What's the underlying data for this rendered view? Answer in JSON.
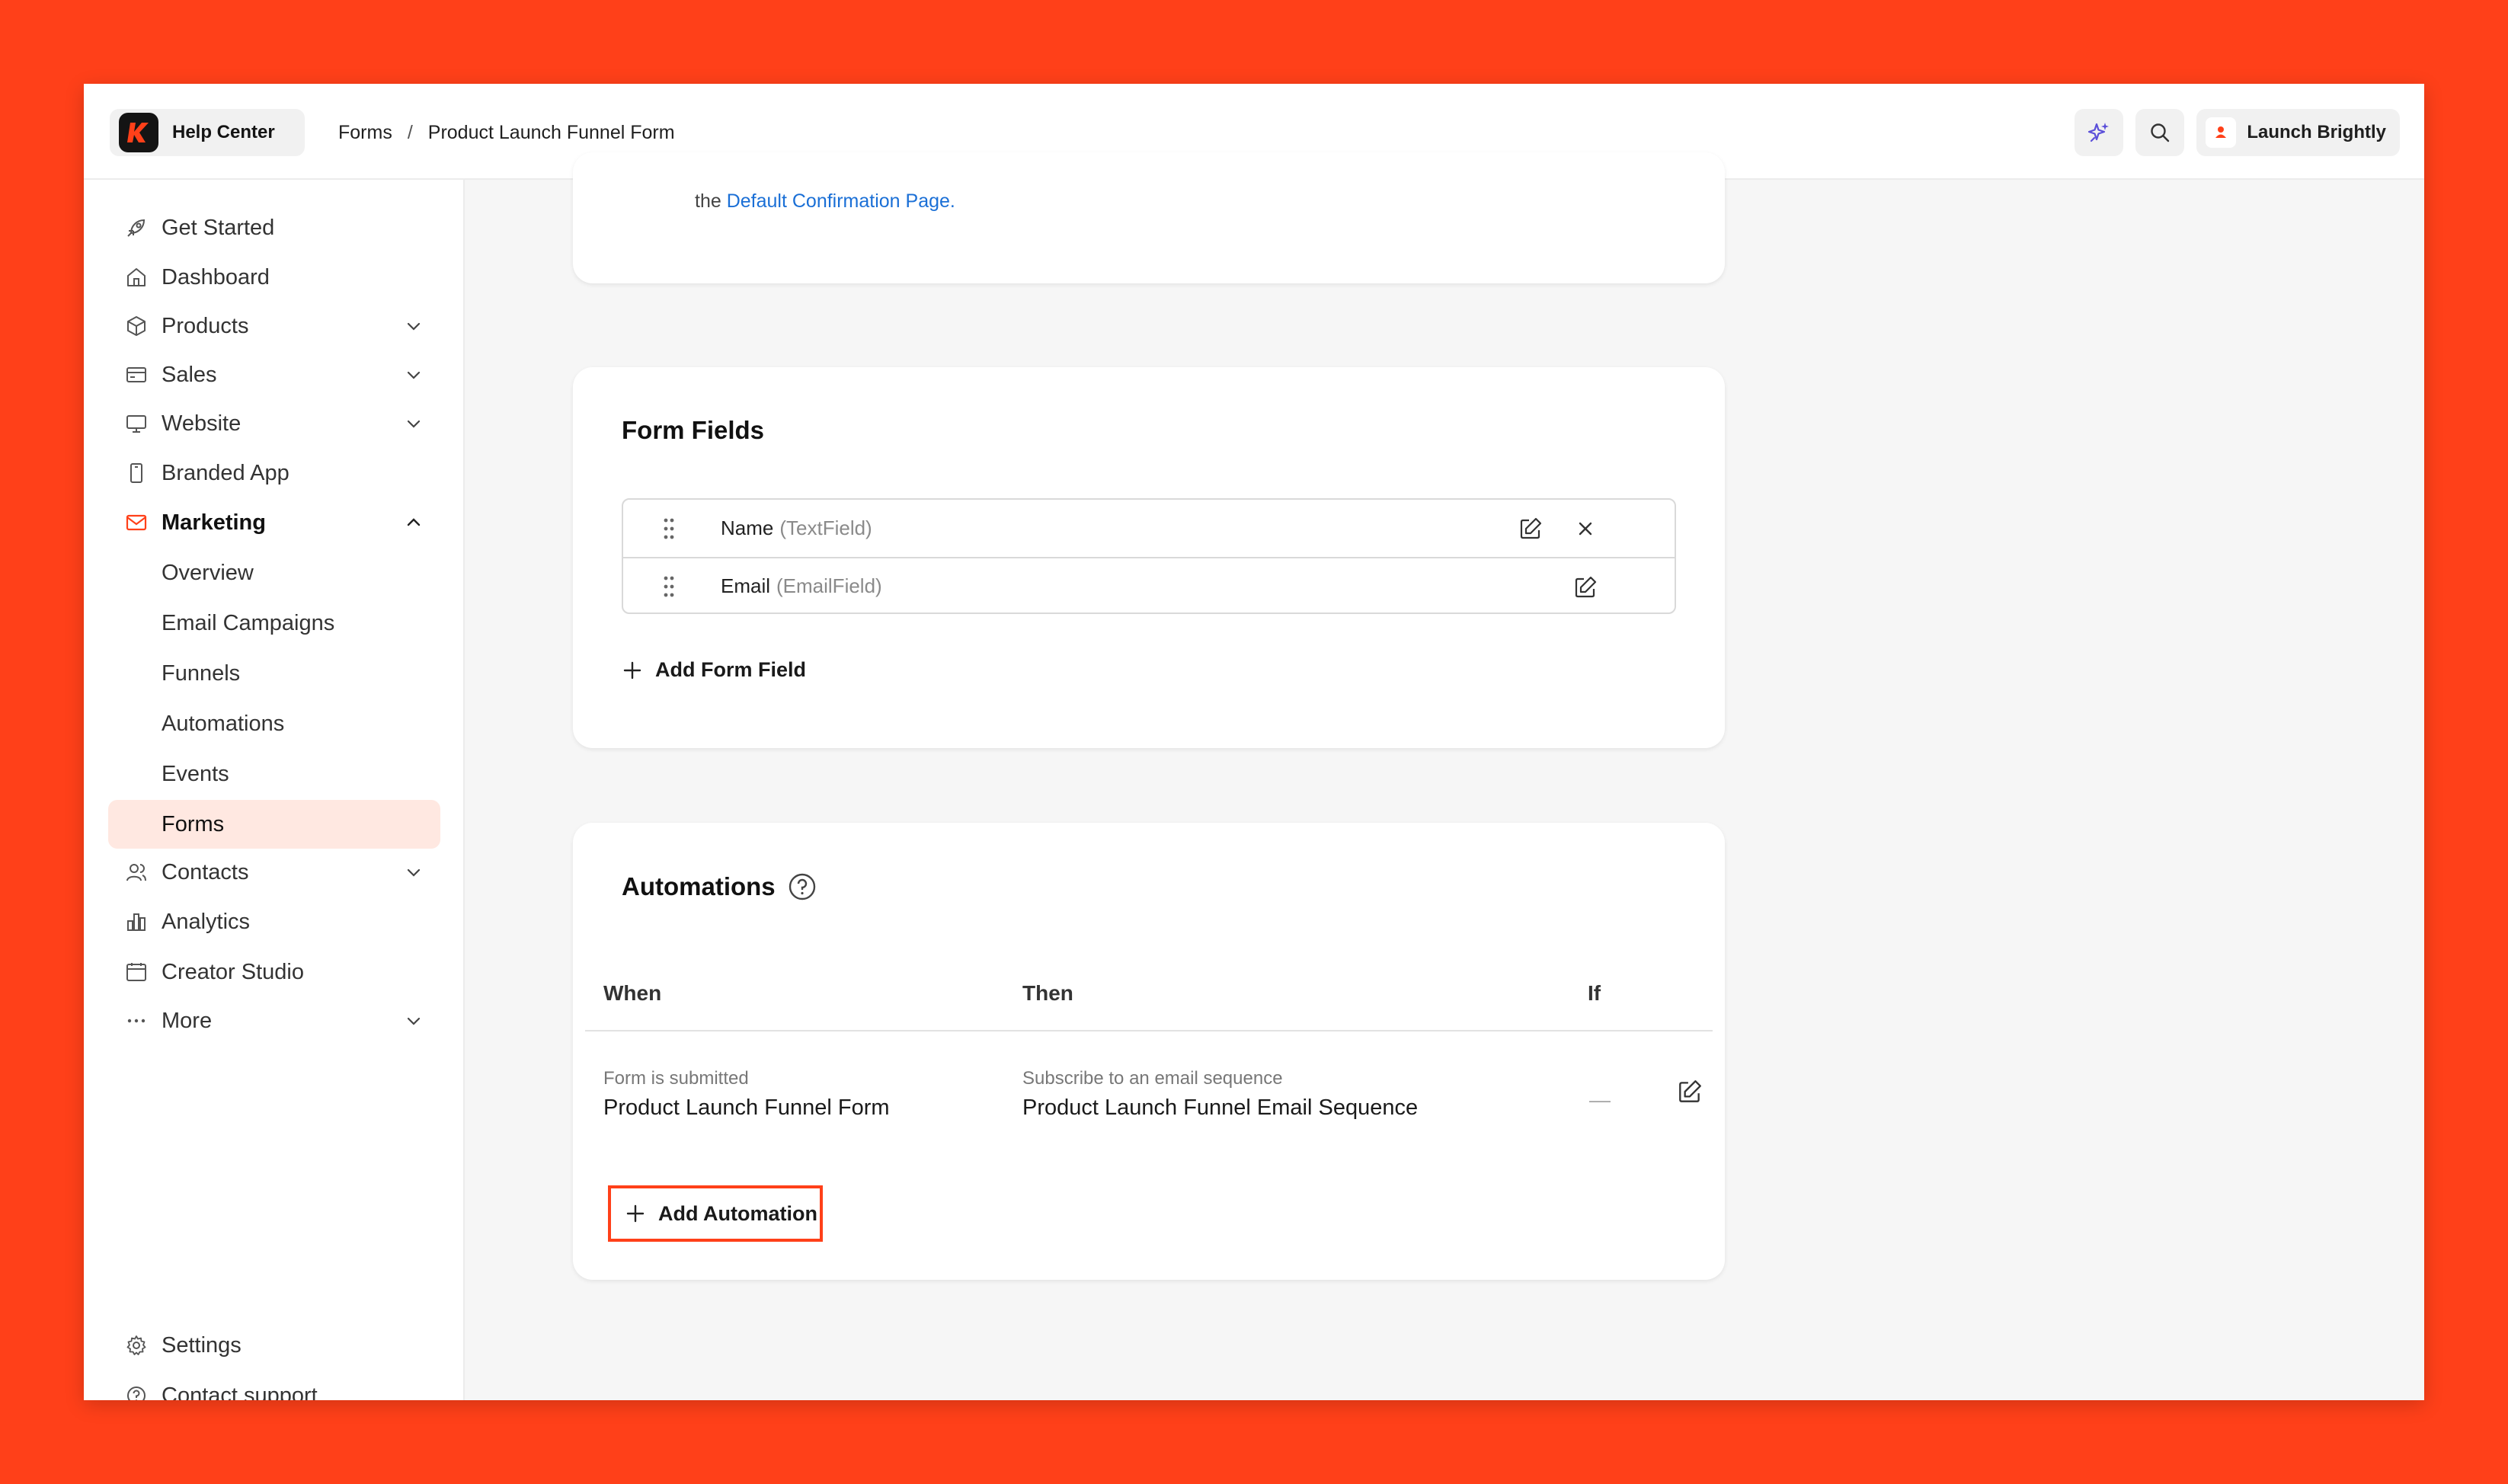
{
  "header": {
    "logo_text": "Help Center",
    "breadcrumb": [
      "Forms",
      "Product Launch Funnel Form"
    ],
    "breadcrumb_separator": "/",
    "account_name": "Launch Brightly"
  },
  "sidebar": {
    "items": [
      {
        "label": "Get Started",
        "icon": "rocket-icon"
      },
      {
        "label": "Dashboard",
        "icon": "home-icon"
      },
      {
        "label": "Products",
        "icon": "box-icon",
        "expandable": true
      },
      {
        "label": "Sales",
        "icon": "credit-card-icon",
        "expandable": true
      },
      {
        "label": "Website",
        "icon": "monitor-icon",
        "expandable": true
      },
      {
        "label": "Branded App",
        "icon": "phone-icon"
      },
      {
        "label": "Marketing",
        "icon": "mail-icon",
        "expandable": true,
        "expanded": true
      },
      {
        "label": "Overview"
      },
      {
        "label": "Email Campaigns"
      },
      {
        "label": "Funnels"
      },
      {
        "label": "Automations"
      },
      {
        "label": "Events"
      },
      {
        "label": "Forms",
        "selected": true
      },
      {
        "label": "Contacts",
        "icon": "users-icon",
        "expandable": true
      },
      {
        "label": "Analytics",
        "icon": "chart-icon"
      },
      {
        "label": "Creator Studio",
        "icon": "calendar-icon"
      },
      {
        "label": "More",
        "icon": "dots-icon",
        "expandable": true
      }
    ],
    "footer": [
      {
        "label": "Settings",
        "icon": "gear-icon"
      },
      {
        "label": "Contact support",
        "icon": "help-circle-icon"
      }
    ]
  },
  "confirmation": {
    "prefix": "the ",
    "link": "Default Confirmation Page",
    "suffix": "."
  },
  "form_fields": {
    "title": "Form Fields",
    "fields": [
      {
        "name": "Name",
        "type": "(TextField)"
      },
      {
        "name": "Email",
        "type": "(EmailField)"
      }
    ],
    "add_label": "Add Form Field"
  },
  "automations": {
    "title": "Automations",
    "columns": {
      "when": "When",
      "then": "Then",
      "if": "If"
    },
    "rows": [
      {
        "when_label": "Form is submitted",
        "when_value": "Product Launch Funnel Form",
        "then_label": "Subscribe to an email sequence",
        "then_value": "Product Launch Funnel Email Sequence",
        "if_value": "—"
      }
    ],
    "add_label": "Add Automation"
  },
  "colors": {
    "brand": "#ff4019",
    "link": "#1a6fd6",
    "selected_bg": "#ffe8e1",
    "highlight_border": "#ff4019"
  }
}
